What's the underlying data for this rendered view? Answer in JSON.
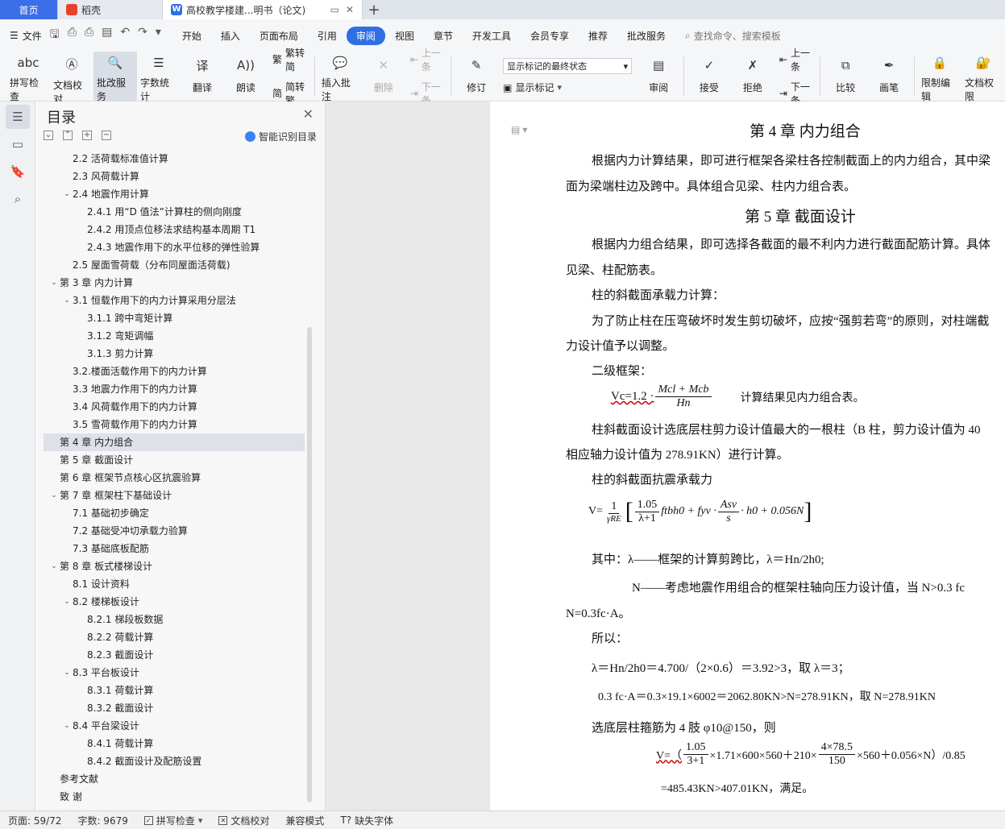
{
  "tabs": {
    "home": "首页",
    "daoke": "稻壳",
    "doc": "高校教学楼建...明书（论文)"
  },
  "menu": {
    "file": "文件",
    "tabs": [
      "开始",
      "插入",
      "页面布局",
      "引用",
      "审阅",
      "视图",
      "章节",
      "开发工具",
      "会员专享",
      "推荐",
      "批改服务"
    ],
    "active_tab": "审阅",
    "search": "查找命令、搜索模板"
  },
  "ribbon": {
    "spell": "拼写检查",
    "doc_check": "文档校对",
    "review_service": "批改服务",
    "word_count": "字数统计",
    "translate": "翻译",
    "read": "朗读",
    "to_traditional": "繁转简",
    "to_simplified": "简转繁",
    "insert_comment": "插入批注",
    "delete": "删除",
    "prev": "上一条",
    "next": "下一条",
    "revise": "修订",
    "display_select": "显示标记的最终状态",
    "show_marks": "显示标记",
    "review": "审阅",
    "accept": "接受",
    "reject": "拒绝",
    "prev2": "上一条",
    "next2": "下一条",
    "compare": "比较",
    "pen": "画笔",
    "restrict": "限制编辑",
    "doc_perm": "文档权限"
  },
  "toc": {
    "title": "目录",
    "smart": "智能识别目录",
    "items": [
      {
        "text": "2.2  活荷载标准值计算",
        "level": 2,
        "caret": ""
      },
      {
        "text": "2.3  风荷载计算",
        "level": 2,
        "caret": ""
      },
      {
        "text": "2.4 地震作用计算",
        "level": 2,
        "caret": "v"
      },
      {
        "text": "2.4.1  用“D 值法”计算柱的侧向刚度",
        "level": 3,
        "caret": ""
      },
      {
        "text": "2.4.2 用顶点位移法求结构基本周期 T1",
        "level": 3,
        "caret": ""
      },
      {
        "text": "2.4.3  地震作用下的水平位移的弹性验算",
        "level": 3,
        "caret": ""
      },
      {
        "text": "2.5  屋面雪荷载（分布同屋面活荷载)",
        "level": 2,
        "caret": ""
      },
      {
        "text": "第 3 章  内力计算",
        "level": 1,
        "caret": "v"
      },
      {
        "text": "3.1  恒载作用下的内力计算采用分层法",
        "level": 2,
        "caret": "v"
      },
      {
        "text": "3.1.1 跨中弯矩计算",
        "level": 3,
        "caret": ""
      },
      {
        "text": "3.1.2 弯矩调幅",
        "level": 3,
        "caret": ""
      },
      {
        "text": "3.1.3 剪力计算",
        "level": 3,
        "caret": ""
      },
      {
        "text": "3.2.楼面活载作用下的内力计算",
        "level": 2,
        "caret": ""
      },
      {
        "text": "3.3  地震力作用下的内力计算",
        "level": 2,
        "caret": ""
      },
      {
        "text": "3.4  风荷载作用下的内力计算",
        "level": 2,
        "caret": ""
      },
      {
        "text": "3.5 雪荷载作用下的内力计算",
        "level": 2,
        "caret": ""
      },
      {
        "text": "第 4 章  内力组合",
        "level": 1,
        "caret": "",
        "active": true
      },
      {
        "text": "第 5 章    截面设计",
        "level": 1,
        "caret": ""
      },
      {
        "text": "第 6 章  框架节点核心区抗震验算",
        "level": 1,
        "caret": ""
      },
      {
        "text": "第 7 章  框架柱下基础设计",
        "level": 1,
        "caret": "v"
      },
      {
        "text": "7.1  基础初步确定",
        "level": 2,
        "caret": ""
      },
      {
        "text": "7.2 基础受冲切承载力验算",
        "level": 2,
        "caret": ""
      },
      {
        "text": "7.3  基础底板配筋",
        "level": 2,
        "caret": ""
      },
      {
        "text": "第 8 章  板式楼梯设计",
        "level": 1,
        "caret": "v"
      },
      {
        "text": "8.1 设计资料",
        "level": 2,
        "caret": ""
      },
      {
        "text": "8.2 楼梯板设计",
        "level": 2,
        "caret": "v"
      },
      {
        "text": "8.2.1 梯段板数据",
        "level": 3,
        "caret": ""
      },
      {
        "text": "8.2.2 荷载计算",
        "level": 3,
        "caret": ""
      },
      {
        "text": "8.2.3 截面设计",
        "level": 3,
        "caret": ""
      },
      {
        "text": "8.3 平台板设计",
        "level": 2,
        "caret": "v"
      },
      {
        "text": "8.3.1 荷载计算",
        "level": 3,
        "caret": ""
      },
      {
        "text": "8.3.2 截面设计",
        "level": 3,
        "caret": ""
      },
      {
        "text": "8.4 平台梁设计",
        "level": 2,
        "caret": "v"
      },
      {
        "text": "8.4.1 荷载计算",
        "level": 3,
        "caret": ""
      },
      {
        "text": "8.4.2 截面设计及配筋设置",
        "level": 3,
        "caret": ""
      },
      {
        "text": "参考文献",
        "level": 1,
        "caret": ""
      },
      {
        "text": "致   谢",
        "level": 1,
        "caret": ""
      }
    ]
  },
  "doc": {
    "h4": "第 4 章  内力组合",
    "p1a": "根据内力计算结果，即可进行框架各梁柱各控制截面上的内力组合，其中梁",
    "p1b": "面为梁端柱边及跨中。具体组合见梁、柱内力组合表。",
    "h5": "第 5 章    截面设计",
    "p2a": "根据内力组合结果，即可选择各截面的最不利内力进行截面配筋计算。具体",
    "p2b": "见梁、柱配筋表。",
    "p3": "柱的斜截面承载力计算：",
    "p4a": "为了防止柱在压弯破坏时发生剪切破坏，应按“强剪若弯”的原则，对柱端截",
    "p4b": "力设计值予以调整。",
    "p5": "二级框架：",
    "f1_left": "Vc=1.2 ·",
    "f1_num": "Mcl + Mcb",
    "f1_den": "Hn",
    "f1_right": "计算结果见内力组合表。",
    "p6a": "柱斜截面设计选底层柱剪力设计值最大的一根柱（B 柱，剪力设计值为 40",
    "p6b": "相应轴力设计值为 278.91KN）进行计算。",
    "p7": "柱的斜截面抗震承载力",
    "f2_v": "V=",
    "f2_n1": "1",
    "f2_d1": "γRE",
    "f2_n2": "1.05",
    "f2_d2": "λ+1",
    "f2_mid": "ftbh0 + fyv ·",
    "f2_n3": "Asv",
    "f2_d3": "s",
    "f2_end": "· h0 + 0.056N",
    "p8": "其中：λ——框架的计算剪跨比，λ＝Hn/2h0;",
    "p9a": "N——考虑地震作用组合的框架柱轴向压力设计值，当  N>0.3 fc",
    "p9b": "N=0.3fc·A。",
    "p10": "所以：",
    "p11": "λ＝Hn/2h0＝4.700/（2×0.6）＝3.92>3，取 λ＝3；",
    "p12": "0.3  fc·A＝0.3×19.1×6002＝2062.80KN>N=278.91KN，取 N=278.91KN",
    "p13": "选底层柱箍筋为 4 肢 φ10@150，则",
    "f3_v": "V=（",
    "f3_n1": "1.05",
    "f3_d1": "3+1",
    "f3_mid": "×1.71×600×560＋210×",
    "f3_n2": "4×78.5",
    "f3_d2": "150",
    "f3_end": "×560＋0.056×N）/0.85",
    "p14": "=485.43KN>407.01KN，满足。"
  },
  "status": {
    "page": "页面: 59/72",
    "words": "字数: 9679",
    "spell": "拼写检查",
    "check": "文档校对",
    "compat": "兼容模式",
    "missing_font": "缺失字体"
  }
}
